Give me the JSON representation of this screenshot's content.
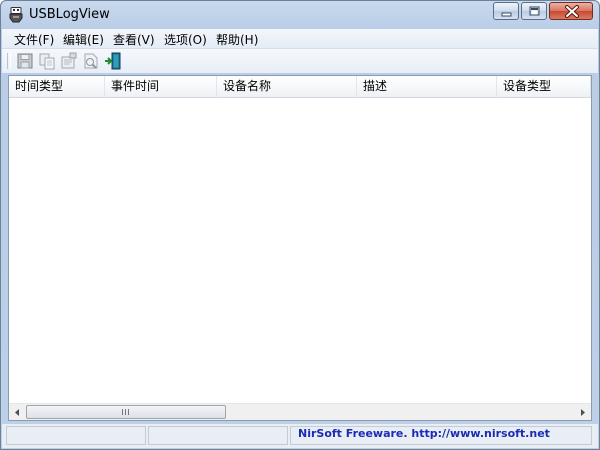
{
  "window": {
    "title": "USBLogView",
    "app_icon": "usb-plug-icon",
    "caption_buttons": [
      "minimize-icon",
      "maximize-icon",
      "close-icon"
    ]
  },
  "menu": {
    "items": [
      {
        "label": "文件(F)"
      },
      {
        "label": "编辑(E)"
      },
      {
        "label": "查看(V)"
      },
      {
        "label": "选项(O)"
      },
      {
        "label": "帮助(H)"
      }
    ]
  },
  "toolbar": {
    "buttons": [
      {
        "icon": "save-icon"
      },
      {
        "icon": "copy-icon"
      },
      {
        "icon": "properties-icon"
      },
      {
        "icon": "html-report-icon"
      },
      {
        "icon": "exit-icon"
      }
    ]
  },
  "list": {
    "columns": [
      {
        "label": "时间类型"
      },
      {
        "label": "事件时间"
      },
      {
        "label": "设备名称"
      },
      {
        "label": "描述"
      },
      {
        "label": "设备类型"
      }
    ],
    "rows": []
  },
  "scrollbar": {
    "left_arrow": "scroll-left-icon",
    "right_arrow": "scroll-right-icon"
  },
  "status": {
    "panels": [
      "",
      "",
      "NirSoft Freeware.  http://www.nirsoft.net"
    ],
    "link_color": "#1a2bb5"
  }
}
